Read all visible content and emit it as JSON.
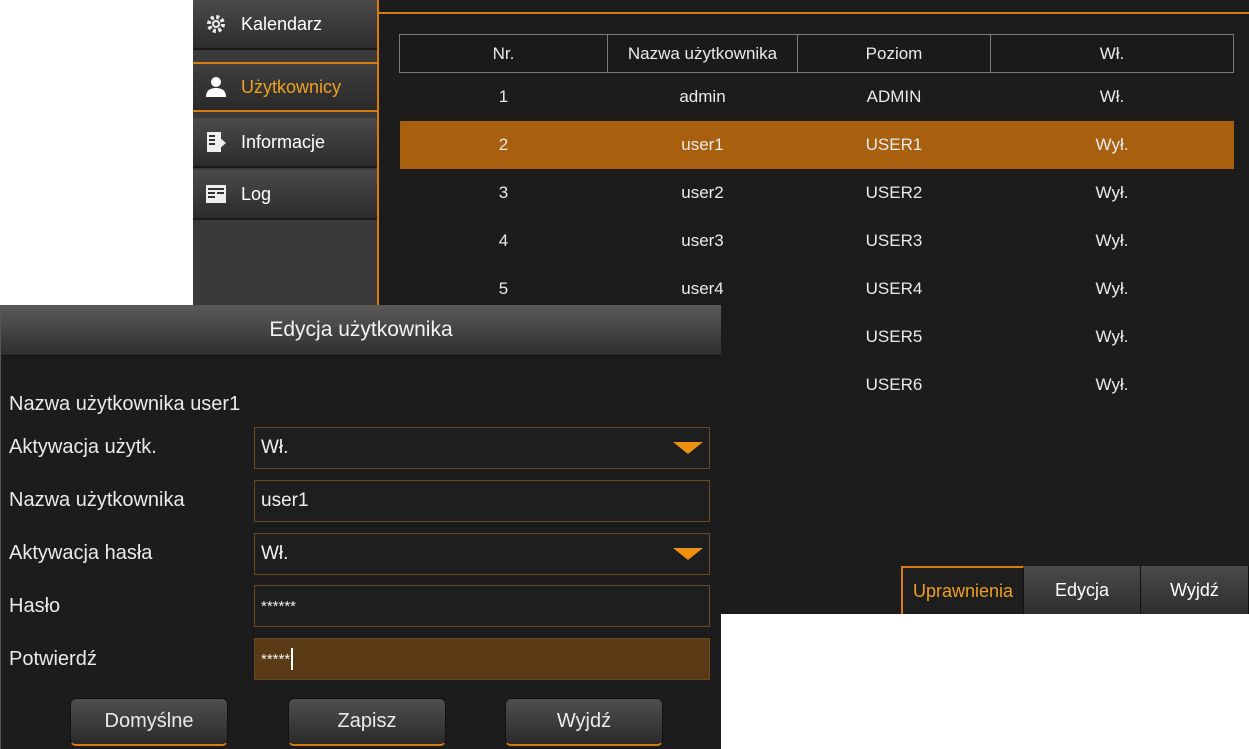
{
  "sidebar": {
    "items": [
      {
        "label": "Kalendarz",
        "icon": "gear-icon"
      },
      {
        "label": "Użytkownicy",
        "icon": "user-icon"
      },
      {
        "label": "Informacje",
        "icon": "info-icon"
      },
      {
        "label": "Log",
        "icon": "log-icon"
      }
    ]
  },
  "table": {
    "headers": [
      "Nr.",
      "Nazwa użytkownika",
      "Poziom",
      "Wł."
    ],
    "rows": [
      [
        "1",
        "admin",
        "ADMIN",
        "Wł."
      ],
      [
        "2",
        "user1",
        "USER1",
        "Wył."
      ],
      [
        "3",
        "user2",
        "USER2",
        "Wył."
      ],
      [
        "4",
        "user3",
        "USER3",
        "Wył."
      ],
      [
        "5",
        "user4",
        "USER4",
        "Wył."
      ],
      [
        "",
        "",
        "USER5",
        "Wył."
      ],
      [
        "",
        "",
        "USER6",
        "Wył."
      ]
    ]
  },
  "tabs": {
    "permissions": "Uprawnienia",
    "edit": "Edycja",
    "exit": "Wyjdź"
  },
  "dialog": {
    "title": "Edycja użytkownika",
    "username_label": "Nazwa użytkownika",
    "username_value": "user1",
    "activation_label": "Aktywacja użytk.",
    "activation_value": "Wł.",
    "name_field_label": "Nazwa użytkownika",
    "name_field_value": "user1",
    "pwd_activation_label": "Aktywacja hasła",
    "pwd_activation_value": "Wł.",
    "password_label": "Hasło",
    "password_value": "******",
    "confirm_label": "Potwierdź",
    "confirm_value": "*****",
    "buttons": {
      "default": "Domyślne",
      "save": "Zapisz",
      "exit": "Wyjdź"
    }
  },
  "colors": {
    "accent": "#d97a10",
    "selected_row": "#a8600f",
    "background": "#1c1c1c"
  }
}
